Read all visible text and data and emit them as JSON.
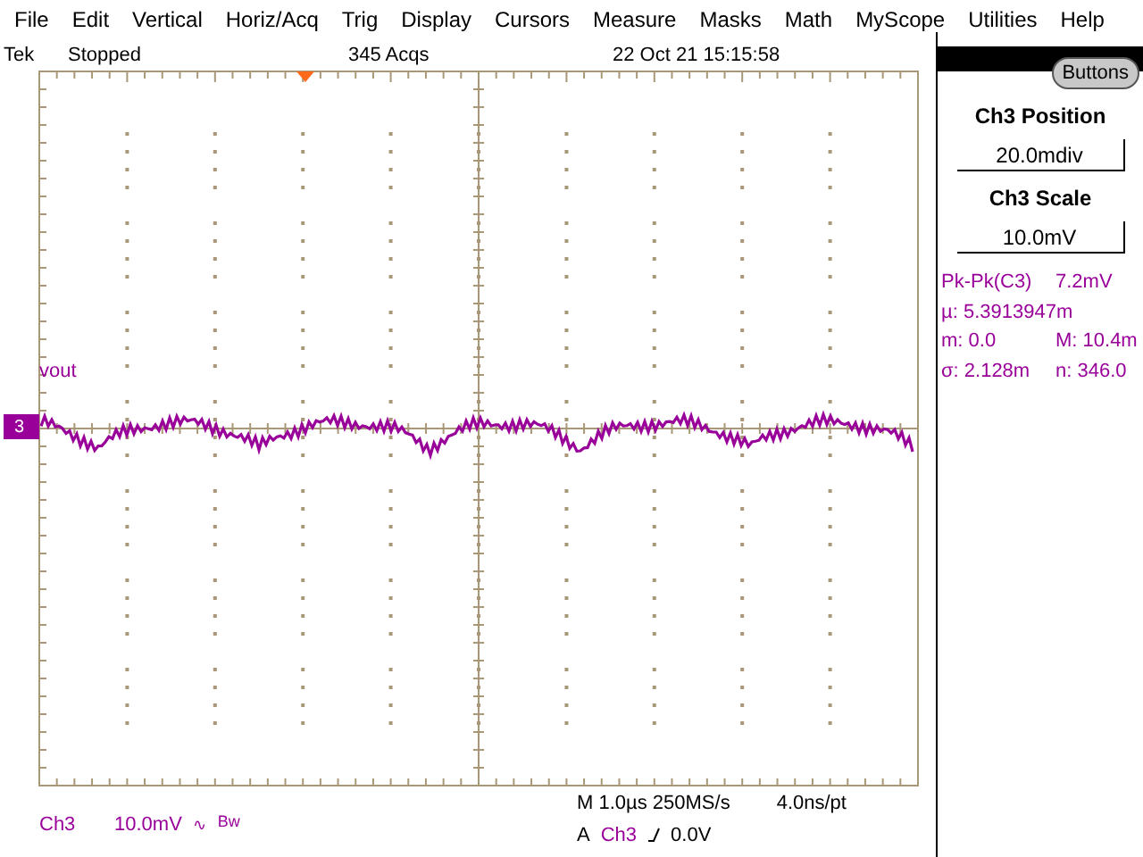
{
  "menu": [
    "File",
    "Edit",
    "Vertical",
    "Horiz/Acq",
    "Trig",
    "Display",
    "Cursors",
    "Measure",
    "Masks",
    "Math",
    "MyScope",
    "Utilities",
    "Help"
  ],
  "status": {
    "brand": "Tek",
    "state": "Stopped",
    "acquisitions": "345 Acqs",
    "datetime": "22 Oct 21 15:15:58"
  },
  "trace": {
    "label": "vout",
    "channel_marker": "3"
  },
  "side_panel": {
    "button": "Buttons",
    "controls": [
      {
        "title": "Ch3 Position",
        "value": "20.0mdiv"
      },
      {
        "title": "Ch3 Scale",
        "value": "10.0mV"
      }
    ],
    "measurements": [
      [
        "Pk-Pk(C3)",
        "7.2mV"
      ],
      [
        "µ: 5.3913947m"
      ],
      [
        "m: 0.0",
        "M: 10.4m"
      ],
      [
        "σ: 2.128m",
        "n: 346.0"
      ]
    ]
  },
  "channel_readout": {
    "channel": "Ch3",
    "scale": "10.0mV",
    "coupling": "∿",
    "bandwidth": "Bw"
  },
  "horizontal_readout": {
    "timebase": "M 1.0µs 250MS/s",
    "resolution": "4.0ns/pt"
  },
  "trigger_readout": {
    "mode": "A",
    "source": "Ch3",
    "level": "0.0V"
  }
}
